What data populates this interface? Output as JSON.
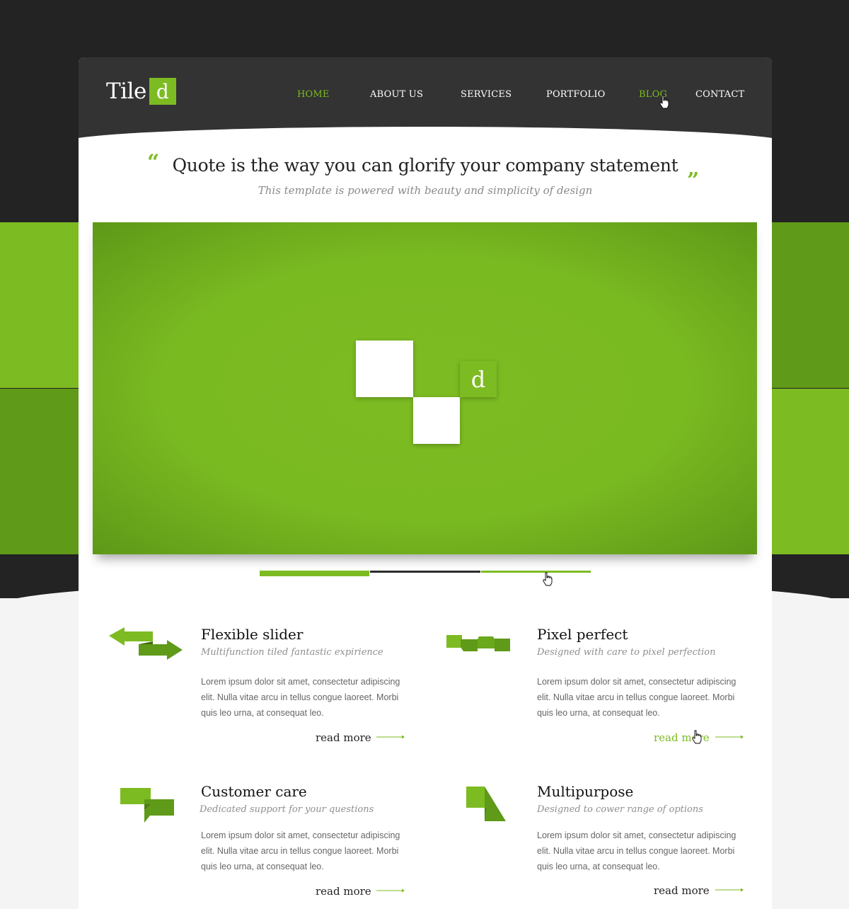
{
  "brand": {
    "logo_text": "Tile",
    "logo_letter": "d"
  },
  "colors": {
    "accent": "#7dbb22",
    "accent_dark": "#5f9a18",
    "dark": "#232323",
    "header": "#333333"
  },
  "nav": {
    "items": [
      {
        "label": "HOME",
        "active": true
      },
      {
        "label": "ABOUT US",
        "active": false
      },
      {
        "label": "SERVICES",
        "active": false
      },
      {
        "label": "PORTFOLIO",
        "active": false
      },
      {
        "label": "BLOG",
        "active": true
      },
      {
        "label": "CONTACT",
        "active": false
      }
    ]
  },
  "quote": {
    "open_mark": "“",
    "close_mark": "”",
    "title": "Quote is the way you can glorify your company statement",
    "subtitle": "This template is powered with beauty and simplicity of design"
  },
  "slider": {
    "tile_letter": "d",
    "pager": [
      {
        "state": "active"
      },
      {
        "state": "inactive"
      },
      {
        "state": "hover"
      }
    ]
  },
  "features": [
    {
      "title": "Flexible slider",
      "subtitle": "Multifunction tiled fantastic expirience",
      "body": "Lorem ipsum dolor sit amet, consectetur adipiscing elit. Nulla vitae arcu in tellus congue laoreet. Morbi quis leo urna, at consequat leo.",
      "more": "read more",
      "icon": "arrows-icon"
    },
    {
      "title": "Pixel perfect",
      "subtitle": "Designed with care to pixel perfection",
      "body": "Lorem ipsum dolor sit amet, consectetur adipiscing elit. Nulla vitae arcu in tellus congue laoreet. Morbi quis leo urna, at consequat leo.",
      "more": "read more",
      "icon": "ribbon-icon"
    },
    {
      "title": "Customer care",
      "subtitle": "Dedicated support for your questions",
      "body": "Lorem ipsum dolor sit amet, consectetur adipiscing elit. Nulla vitae arcu in tellus congue laoreet. Morbi quis leo urna, at consequat leo.",
      "more": "read more",
      "icon": "speech-bubbles-icon"
    },
    {
      "title": "Multipurpose",
      "subtitle": "Designed to cower range of options",
      "body": "Lorem ipsum dolor sit amet, consectetur adipiscing elit. Nulla vitae arcu in tellus congue laoreet. Morbi quis leo urna, at consequat leo.",
      "more": "read more",
      "icon": "folded-tile-icon"
    }
  ]
}
